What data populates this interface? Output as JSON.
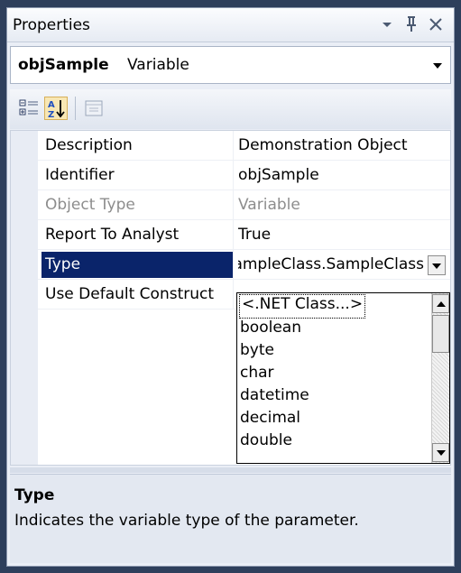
{
  "window": {
    "title": "Properties",
    "icons": [
      "dropdown-arrow-icon",
      "pin-icon",
      "close-icon"
    ]
  },
  "object_selector": {
    "name": "objSample",
    "kind": "Variable"
  },
  "toolbar": {
    "buttons": [
      "categorized-icon",
      "alphabetical-icon",
      "property-pages-icon"
    ],
    "active": "alphabetical-icon"
  },
  "grid": {
    "rows": [
      {
        "name": "Description",
        "value": "Demonstration Object",
        "state": "normal"
      },
      {
        "name": "Identifier",
        "value": "objSample",
        "state": "normal"
      },
      {
        "name": "Object Type",
        "value": "Variable",
        "state": "readonly"
      },
      {
        "name": "Report To Analyst",
        "value": "True",
        "state": "normal"
      },
      {
        "name": "Type",
        "value": "ampleClass.SampleClass",
        "state": "selected"
      },
      {
        "name": "Use Default Construct",
        "value": "",
        "state": "normal"
      }
    ]
  },
  "type_dropdown": {
    "options": [
      "<.NET Class...>",
      "boolean",
      "byte",
      "char",
      "datetime",
      "decimal",
      "double"
    ],
    "focused_option": "<.NET Class...>"
  },
  "description": {
    "title": "Type",
    "text": "Indicates the variable type of the parameter."
  },
  "colors": {
    "selection": "#0a246a",
    "panel_background": "#eaeef6",
    "frame": "#2e3f5c"
  }
}
